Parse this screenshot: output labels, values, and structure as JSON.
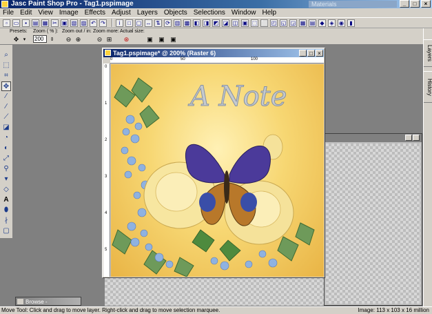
{
  "window": {
    "title": "Jasc Paint Shop Pro - Tag1.pspimage",
    "materials_title": "Materials"
  },
  "menu": [
    "File",
    "Edit",
    "View",
    "Image",
    "Effects",
    "Adjust",
    "Layers",
    "Objects",
    "Selections",
    "Window",
    "Help"
  ],
  "tool_options": {
    "presets_label": "Presets:",
    "zoom_label": "Zoom ( % ):",
    "zoom_value": "200",
    "zoom_out_label": "Zoom out / in:",
    "zoom_more_label": "Zoom more:",
    "actual_size_label": "Actual size:"
  },
  "right_palette": {
    "tabs": [
      "Layers",
      "History"
    ]
  },
  "document": {
    "title": "Tag1.pspimage* @ 200% (Raster 6)",
    "canvas_text": "A Note",
    "hruler_ticks": [
      "0",
      "50",
      "100"
    ],
    "vruler_ticks": [
      "0",
      "1",
      "2",
      "3",
      "4",
      "5"
    ]
  },
  "browse": {
    "title": "Browse -"
  },
  "status": {
    "left": "Move Tool: Click and drag to move layer. Right-click and drag to move selection marquee.",
    "right": "Image: 113 x 103 x 16 million"
  },
  "icons": {
    "tools": [
      "zoom-icon",
      "selection-icon",
      "crop-icon",
      "move-icon",
      "eyedropper-icon",
      "paintbrush-icon",
      "clone-icon",
      "eraser-icon",
      "dodge-icon",
      "smudge-icon",
      "warp-icon",
      "fill-icon",
      "picture-tube-icon",
      "text-icon",
      "shape-icon",
      "pen-icon",
      "airbrush-icon"
    ]
  }
}
